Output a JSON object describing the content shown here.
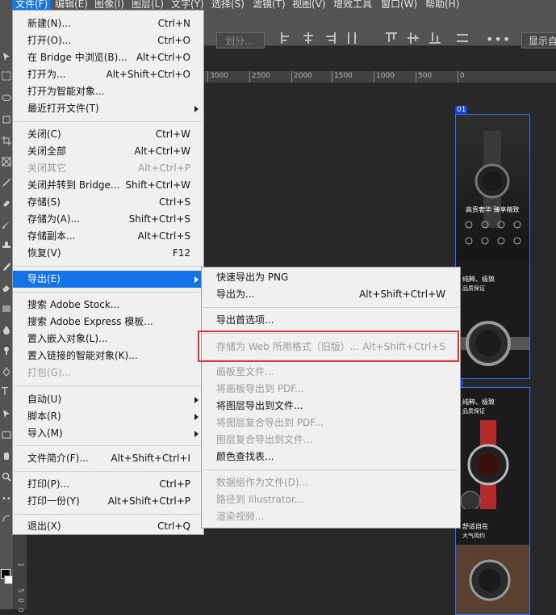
{
  "menubar": {
    "items": [
      "文件(F)",
      "编辑(E)",
      "图像(I)",
      "图层(L)",
      "文字(Y)",
      "选择(S)",
      "滤镜(T)",
      "视图(V)",
      "增效工具",
      "窗口(W)",
      "帮助(H)"
    ]
  },
  "options_bar": {
    "slices_placeholder": "划分...",
    "more_label": "•••",
    "show_label": "显示自"
  },
  "ruler": {
    "h_ticks": [
      "3000",
      "2500",
      "2000",
      "1500",
      "1000",
      "500",
      "0"
    ],
    "v_ticks": [
      "1",
      "5",
      "0",
      "0"
    ]
  },
  "artboards": [
    {
      "label": "01",
      "lines": [
        "高贵奢华 臻享精致",
        "纯粹、极致",
        "品质保证"
      ]
    },
    {
      "label": "2",
      "lines": [
        "纯粹、极致",
        "品质保证",
        "舒适自在",
        "大气简约"
      ]
    }
  ],
  "file_menu": {
    "items": [
      {
        "label": "新建(N)...",
        "shortcut": "Ctrl+N"
      },
      {
        "label": "打开(O)...",
        "shortcut": "Ctrl+O"
      },
      {
        "label": "在 Bridge 中浏览(B)...",
        "shortcut": "Alt+Ctrl+O"
      },
      {
        "label": "打开为...",
        "shortcut": "Alt+Shift+Ctrl+O"
      },
      {
        "label": "打开为智能对象...",
        "shortcut": ""
      },
      {
        "label": "最近打开文件(T)",
        "shortcut": ""
      },
      {
        "label": "关闭(C)",
        "shortcut": "Ctrl+W"
      },
      {
        "label": "关闭全部",
        "shortcut": "Alt+Ctrl+W"
      },
      {
        "label": "关闭其它",
        "shortcut": "Alt+Ctrl+P"
      },
      {
        "label": "关闭并转到 Bridge...",
        "shortcut": "Shift+Ctrl+W"
      },
      {
        "label": "存储(S)",
        "shortcut": "Ctrl+S"
      },
      {
        "label": "存储为(A)...",
        "shortcut": "Shift+Ctrl+S"
      },
      {
        "label": "存储副本...",
        "shortcut": "Alt+Ctrl+S"
      },
      {
        "label": "恢复(V)",
        "shortcut": "F12"
      },
      {
        "label": "导出(E)",
        "shortcut": ""
      },
      {
        "label": "搜索 Adobe Stock...",
        "shortcut": ""
      },
      {
        "label": "搜索 Adobe Express 模板...",
        "shortcut": ""
      },
      {
        "label": "置入嵌入对象(L)...",
        "shortcut": ""
      },
      {
        "label": "置入链接的智能对象(K)...",
        "shortcut": ""
      },
      {
        "label": "打包(G)...",
        "shortcut": ""
      },
      {
        "label": "自动(U)",
        "shortcut": ""
      },
      {
        "label": "脚本(R)",
        "shortcut": ""
      },
      {
        "label": "导入(M)",
        "shortcut": ""
      },
      {
        "label": "文件简介(F)...",
        "shortcut": "Alt+Shift+Ctrl+I"
      },
      {
        "label": "打印(P)...",
        "shortcut": "Ctrl+P"
      },
      {
        "label": "打印一份(Y)",
        "shortcut": "Alt+Shift+Ctrl+P"
      },
      {
        "label": "退出(X)",
        "shortcut": "Ctrl+Q"
      }
    ]
  },
  "export_menu": {
    "items": [
      {
        "label": "快速导出为 PNG",
        "shortcut": ""
      },
      {
        "label": "导出为...",
        "shortcut": "Alt+Shift+Ctrl+W"
      },
      {
        "label": "导出首选项...",
        "shortcut": ""
      },
      {
        "label": "存储为 Web 所用格式（旧版）...",
        "shortcut": "Alt+Shift+Ctrl+S"
      },
      {
        "label": "画板至文件...",
        "shortcut": ""
      },
      {
        "label": "将画板导出到 PDF...",
        "shortcut": ""
      },
      {
        "label": "将图层导出到文件...",
        "shortcut": ""
      },
      {
        "label": "将图层复合导出到 PDF...",
        "shortcut": ""
      },
      {
        "label": "图层复合导出到文件...",
        "shortcut": ""
      },
      {
        "label": "颜色查找表...",
        "shortcut": ""
      },
      {
        "label": "数据组作为文件(D)...",
        "shortcut": ""
      },
      {
        "label": "路径到 Illustrator...",
        "shortcut": ""
      },
      {
        "label": "渲染视频...",
        "shortcut": ""
      }
    ]
  },
  "colors": {
    "highlight": "#1473e6",
    "annotation_box": "#d23a3a",
    "artboard_border": "#2d6fff"
  }
}
